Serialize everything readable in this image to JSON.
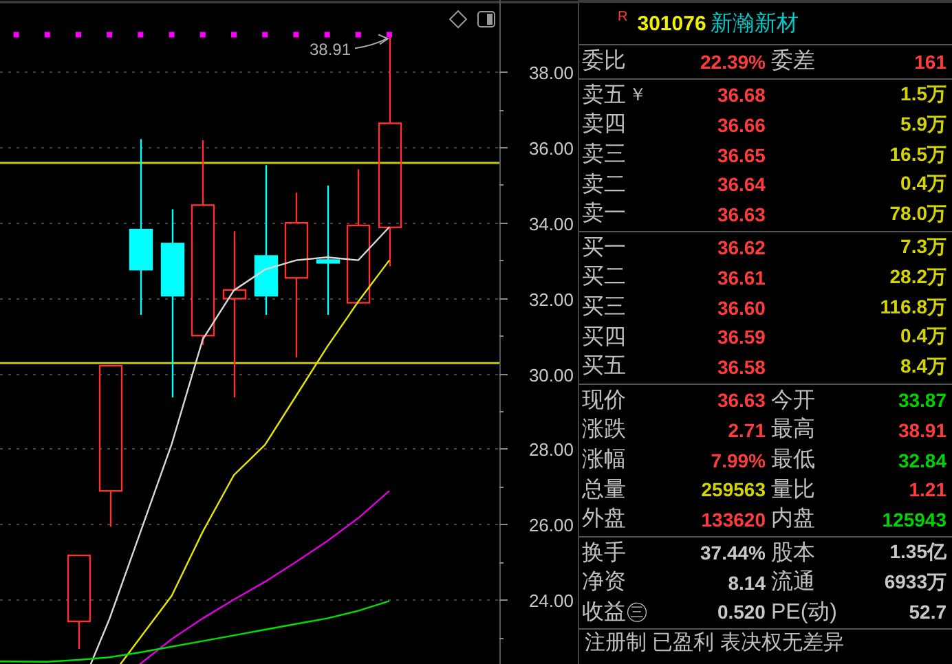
{
  "chart": {
    "price_axis_labels": [
      "38.00",
      "36.00",
      "34.00",
      "32.00",
      "30.00",
      "28.00",
      "26.00",
      "24.00"
    ],
    "peak_label": "38.91"
  },
  "quote_header": {
    "badge": "R",
    "code": "301076",
    "name": "新瀚新材"
  },
  "order_ratio": [
    {
      "label": "委比",
      "value": "22.39%",
      "color": "#ff3c3c"
    },
    {
      "label": "委差",
      "value": "161",
      "color": "#ff3c3c"
    }
  ],
  "asks": [
    {
      "label": "卖五",
      "marker": "￥",
      "price": "36.68",
      "volume": "1.5万"
    },
    {
      "label": "卖四",
      "price": "36.66",
      "volume": "5.9万"
    },
    {
      "label": "卖三",
      "price": "36.65",
      "volume": "16.5万"
    },
    {
      "label": "卖二",
      "price": "36.64",
      "volume": "0.4万"
    },
    {
      "label": "卖一",
      "price": "36.63",
      "volume": "78.0万"
    }
  ],
  "bids": [
    {
      "label": "买一",
      "price": "36.62",
      "volume": "7.3万"
    },
    {
      "label": "买二",
      "price": "36.61",
      "volume": "28.2万"
    },
    {
      "label": "买三",
      "price": "36.60",
      "volume": "116.8万"
    },
    {
      "label": "买四",
      "price": "36.59",
      "volume": "0.4万"
    },
    {
      "label": "买五",
      "price": "36.58",
      "volume": "8.4万"
    }
  ],
  "quote_stats": [
    [
      {
        "label": "现价",
        "value": "36.63",
        "color": "#ff3c3c"
      },
      {
        "label": "今开",
        "value": "33.87",
        "color": "#00d200"
      }
    ],
    [
      {
        "label": "涨跌",
        "value": "2.71",
        "color": "#ff3c3c"
      },
      {
        "label": "最高",
        "value": "38.91",
        "color": "#ff3c3c"
      }
    ],
    [
      {
        "label": "涨幅",
        "value": "7.99%",
        "color": "#ff3c3c"
      },
      {
        "label": "最低",
        "value": "32.84",
        "color": "#00d200"
      }
    ],
    [
      {
        "label": "总量",
        "value": "259563",
        "color": "#d4d400"
      },
      {
        "label": "量比",
        "value": "1.21",
        "color": "#ff3c3c"
      }
    ],
    [
      {
        "label": "外盘",
        "value": "133620",
        "color": "#ff3c3c"
      },
      {
        "label": "内盘",
        "value": "125943",
        "color": "#00d200"
      }
    ]
  ],
  "fundamentals": [
    [
      {
        "label": "换手",
        "value": "37.44%",
        "color": "#c8c8c8"
      },
      {
        "label": "股本",
        "value": "1.35亿",
        "color": "#c8c8c8"
      }
    ],
    [
      {
        "label": "净资",
        "value": "8.14",
        "color": "#c8c8c8"
      },
      {
        "label": "流通",
        "value": "6933万",
        "color": "#c8c8c8"
      }
    ],
    [
      {
        "label": "收益㊂",
        "value": "0.520",
        "color": "#c8c8c8"
      },
      {
        "label": "PE(动)",
        "value": "52.7",
        "color": "#c8c8c8"
      }
    ]
  ],
  "footer": "注册制 已盈利 表决权无差异"
}
